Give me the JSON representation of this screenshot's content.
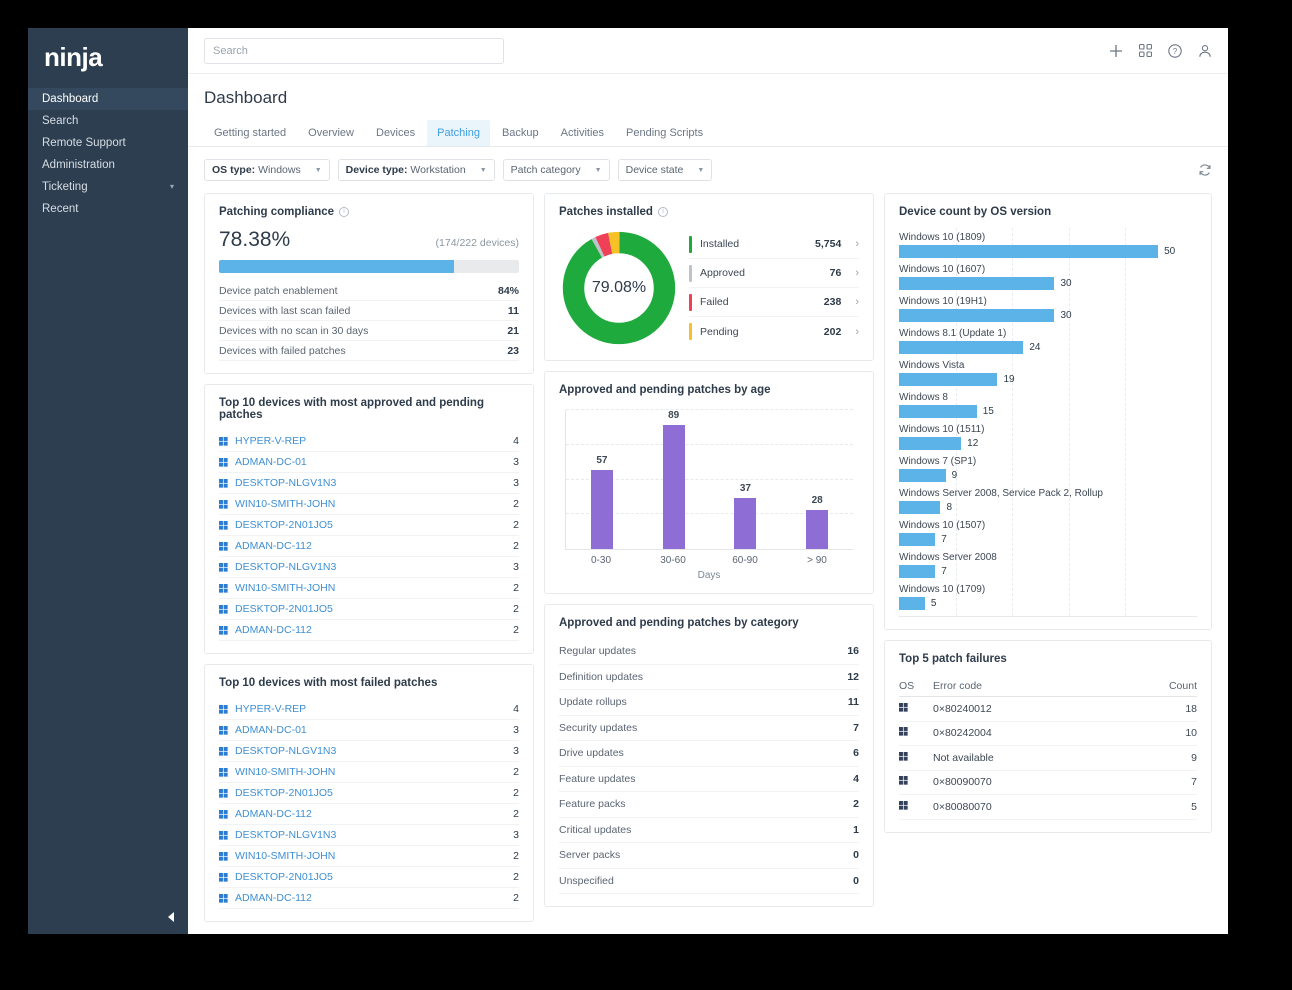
{
  "sidebar": {
    "logo": "ninja",
    "items": [
      {
        "label": "Dashboard",
        "active": true,
        "chevron": ""
      },
      {
        "label": "Search",
        "active": false,
        "chevron": ""
      },
      {
        "label": "Remote Support",
        "active": false,
        "chevron": ""
      },
      {
        "label": "Administration",
        "active": false,
        "chevron": ""
      },
      {
        "label": "Ticketing",
        "active": false,
        "chevron": "⌄"
      },
      {
        "label": "Recent",
        "active": false,
        "chevron": ""
      }
    ]
  },
  "topbar": {
    "search_placeholder": "Search",
    "search_value": "",
    "icons": [
      "plus-icon",
      "apps-grid-icon",
      "help-icon",
      "user-icon"
    ]
  },
  "page": {
    "title": "Dashboard",
    "tabs": [
      {
        "label": "Getting started",
        "active": false
      },
      {
        "label": "Overview",
        "active": false
      },
      {
        "label": "Devices",
        "active": false
      },
      {
        "label": "Patching",
        "active": true
      },
      {
        "label": "Backup",
        "active": false
      },
      {
        "label": "Activities",
        "active": false
      },
      {
        "label": "Pending Scripts",
        "active": false
      }
    ]
  },
  "filters": [
    {
      "prefix": "OS type:",
      "value": "Windows"
    },
    {
      "prefix": "Device type:",
      "value": "Workstation"
    },
    {
      "prefix": "",
      "value": "Patch category"
    },
    {
      "prefix": "",
      "value": "Device state"
    }
  ],
  "compliance": {
    "title": "Patching compliance",
    "percent": "78.38%",
    "devices": "(174/222 devices)",
    "bar_fill_percent": 78.38,
    "rows": [
      {
        "label": "Device patch enablement",
        "value": "84%"
      },
      {
        "label": "Devices with last scan failed",
        "value": "11"
      },
      {
        "label": "Devices with no scan in 30 days",
        "value": "21"
      },
      {
        "label": "Devices with failed patches",
        "value": "23"
      }
    ]
  },
  "patches_installed": {
    "title": "Patches installed",
    "center": "79.08%",
    "legend": [
      {
        "label": "Installed",
        "value": "5,754",
        "color": "#1eaa3c"
      },
      {
        "label": "Approved",
        "value": "76",
        "color": "#bdc3c7"
      },
      {
        "label": "Failed",
        "value": "238",
        "color": "#ee4056"
      },
      {
        "label": "Pending",
        "value": "202",
        "color": "#f5c126"
      }
    ]
  },
  "top_approved_pending": {
    "title": "Top 10 devices with most approved and pending patches",
    "rows": [
      {
        "name": "HYPER-V-REP",
        "value": "4"
      },
      {
        "name": "ADMAN-DC-01",
        "value": "3"
      },
      {
        "name": "DESKTOP-NLGV1N3",
        "value": "3"
      },
      {
        "name": "WIN10-SMITH-JOHN",
        "value": "2"
      },
      {
        "name": "DESKTOP-2N01JO5",
        "value": "2"
      },
      {
        "name": "ADMAN-DC-112",
        "value": "2"
      },
      {
        "name": "DESKTOP-NLGV1N3",
        "value": "3"
      },
      {
        "name": "WIN10-SMITH-JOHN",
        "value": "2"
      },
      {
        "name": "DESKTOP-2N01JO5",
        "value": "2"
      },
      {
        "name": "ADMAN-DC-112",
        "value": "2"
      }
    ]
  },
  "top_failed": {
    "title": "Top 10 devices with most failed patches",
    "rows": [
      {
        "name": "HYPER-V-REP",
        "value": "4"
      },
      {
        "name": "ADMAN-DC-01",
        "value": "3"
      },
      {
        "name": "DESKTOP-NLGV1N3",
        "value": "3"
      },
      {
        "name": "WIN10-SMITH-JOHN",
        "value": "2"
      },
      {
        "name": "DESKTOP-2N01JO5",
        "value": "2"
      },
      {
        "name": "ADMAN-DC-112",
        "value": "2"
      },
      {
        "name": "DESKTOP-NLGV1N3",
        "value": "3"
      },
      {
        "name": "WIN10-SMITH-JOHN",
        "value": "2"
      },
      {
        "name": "DESKTOP-2N01JO5",
        "value": "2"
      },
      {
        "name": "ADMAN-DC-112",
        "value": "2"
      }
    ]
  },
  "by_category": {
    "title": "Approved and pending patches by category",
    "rows": [
      {
        "label": "Regular updates",
        "value": "16"
      },
      {
        "label": "Definition updates",
        "value": "12"
      },
      {
        "label": "Update rollups",
        "value": "11"
      },
      {
        "label": "Security updates",
        "value": "7"
      },
      {
        "label": "Drive updates",
        "value": "6"
      },
      {
        "label": "Feature updates",
        "value": "4"
      },
      {
        "label": "Feature packs",
        "value": "2"
      },
      {
        "label": "Critical updates",
        "value": "1"
      },
      {
        "label": "Server packs",
        "value": "0"
      },
      {
        "label": "Unspecified",
        "value": "0"
      }
    ]
  },
  "patch_failures": {
    "title": "Top 5 patch failures",
    "columns": [
      "OS",
      "Error code",
      "Count"
    ],
    "rows": [
      {
        "os": "windows-icon",
        "code": "0×80240012",
        "count": "18"
      },
      {
        "os": "windows-icon",
        "code": "0×80242004",
        "count": "10"
      },
      {
        "os": "windows-icon",
        "code": "Not available",
        "count": "9"
      },
      {
        "os": "windows-icon",
        "code": "0×80090070",
        "count": "7"
      },
      {
        "os": "windows-icon",
        "code": "0×80080070",
        "count": "5"
      }
    ]
  },
  "chart_data": [
    {
      "type": "pie",
      "title": "Patches installed",
      "center_label": "79.08%",
      "labels": [
        "Installed",
        "Approved",
        "Failed",
        "Pending"
      ],
      "values": [
        5754,
        76,
        238,
        202
      ],
      "colors": [
        "#1eaa3c",
        "#bdc3c7",
        "#ee4056",
        "#f5c126"
      ],
      "legend": "right"
    },
    {
      "type": "bar",
      "title": "Approved and pending patches by age",
      "categories": [
        "0-30",
        "30-60",
        "60-90",
        "> 90"
      ],
      "values": [
        57,
        89,
        37,
        28
      ],
      "xlabel": "Days",
      "ylabel": "",
      "ylim": [
        0,
        100
      ],
      "grid": true,
      "color": "#8e6ed4"
    },
    {
      "type": "bar",
      "orientation": "horizontal",
      "title": "Device count by OS version",
      "categories": [
        "Windows 10 (1809)",
        "Windows 10 (1607)",
        "Windows 10 (19H1)",
        "Windows 8.1 (Update 1)",
        "Windows Vista",
        "Windows 8",
        "Windows 10 (1511)",
        "Windows 7 (SP1)",
        "Windows Server 2008, Service Pack 2, Rollup",
        "Windows 10 (1507)",
        "Windows Server 2008",
        "Windows 10 (1709)"
      ],
      "values": [
        50,
        30,
        30,
        24,
        19,
        15,
        12,
        9,
        8,
        7,
        7,
        5
      ],
      "xlim": [
        0,
        55
      ],
      "grid": true,
      "color": "#5cb3e8"
    },
    {
      "type": "bar",
      "orientation": "horizontal",
      "title": "Approved and pending patches by category",
      "categories": [
        "Regular updates",
        "Definition updates",
        "Update rollups",
        "Security updates",
        "Drive updates",
        "Feature updates",
        "Feature packs",
        "Critical updates",
        "Server packs",
        "Unspecified"
      ],
      "values": [
        16,
        12,
        11,
        7,
        6,
        4,
        2,
        1,
        0,
        0
      ]
    }
  ],
  "os_chart": {
    "title": "Device count by OS version"
  },
  "age_chart": {
    "title": "Approved and pending patches by age",
    "xlabel": "Days"
  }
}
